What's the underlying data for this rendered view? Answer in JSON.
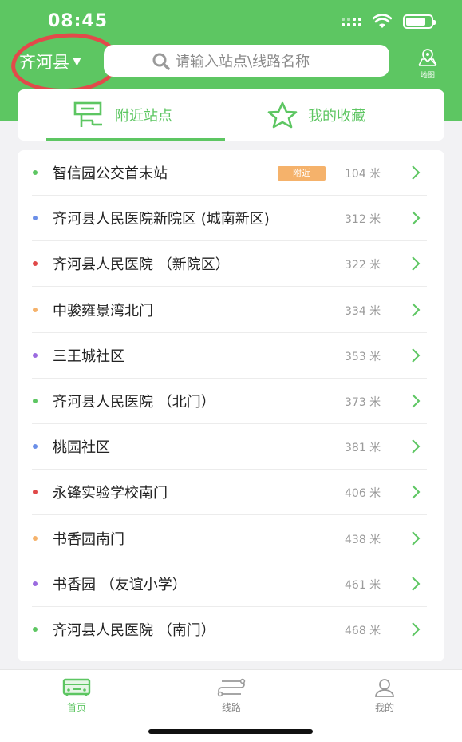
{
  "status_bar": {
    "time": "08:45"
  },
  "header": {
    "city": "齐河县",
    "city_arrow": "▼",
    "search_placeholder": "请输入站点\\线路名称",
    "map_label": "地图"
  },
  "tabs": [
    {
      "label": "附近站点",
      "active": true
    },
    {
      "label": "我的收藏",
      "active": false
    }
  ],
  "stations": [
    {
      "name": "智信园公交首末站",
      "badge": "附近",
      "distance": "104 米",
      "dot_color": "#5dc662"
    },
    {
      "name": "齐河县人民医院新院区 (城南新区)",
      "badge": "",
      "distance": "312 米",
      "dot_color": "#6b8fe8"
    },
    {
      "name": "齐河县人民医院 （新院区）",
      "badge": "",
      "distance": "322 米",
      "dot_color": "#e04848"
    },
    {
      "name": "中骏雍景湾北门",
      "badge": "",
      "distance": "334 米",
      "dot_color": "#f5b26b"
    },
    {
      "name": "三王城社区",
      "badge": "",
      "distance": "353 米",
      "dot_color": "#9b6be0"
    },
    {
      "name": "齐河县人民医院 （北门）",
      "badge": "",
      "distance": "373 米",
      "dot_color": "#5dc662"
    },
    {
      "name": "桃园社区",
      "badge": "",
      "distance": "381 米",
      "dot_color": "#6b8fe8"
    },
    {
      "name": "永锋实验学校南门",
      "badge": "",
      "distance": "406 米",
      "dot_color": "#e04848"
    },
    {
      "name": "书香园南门",
      "badge": "",
      "distance": "438 米",
      "dot_color": "#f5b26b"
    },
    {
      "name": "书香园 （友谊小学）",
      "badge": "",
      "distance": "461 米",
      "dot_color": "#9b6be0"
    },
    {
      "name": "齐河县人民医院 （南门）",
      "badge": "",
      "distance": "468 米",
      "dot_color": "#5dc662"
    }
  ],
  "bottom_nav": [
    {
      "label": "首页",
      "active": true
    },
    {
      "label": "线路",
      "active": false
    },
    {
      "label": "我的",
      "active": false
    }
  ],
  "colors": {
    "brand_green": "#5dc662",
    "badge_orange": "#f5b26b",
    "annotation_red": "#e24a4a"
  }
}
